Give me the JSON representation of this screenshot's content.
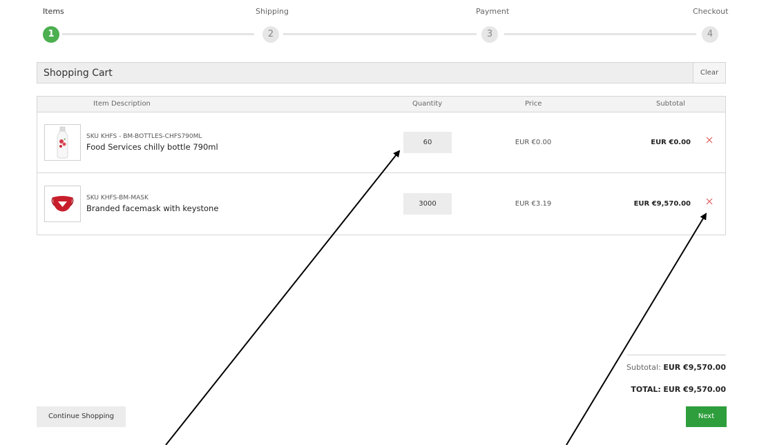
{
  "steps": [
    {
      "label": "Items",
      "number": "1"
    },
    {
      "label": "Shipping",
      "number": "2"
    },
    {
      "label": "Payment",
      "number": "3"
    },
    {
      "label": "Checkout",
      "number": "4"
    }
  ],
  "cart": {
    "title": "Shopping Cart",
    "clear_label": "Clear",
    "columns": {
      "description": "Item Description",
      "quantity": "Quantity",
      "price": "Price",
      "subtotal": "Subtotal"
    },
    "items": [
      {
        "sku": "SKU KHFS - BM-BOTTLES-CHFS790ML",
        "name": "Food Services chilly bottle 790ml",
        "quantity": "60",
        "price": "EUR €0.00",
        "subtotal": "EUR €0.00",
        "thumb_icon": "bottle-icon",
        "remove_icon": "close-icon"
      },
      {
        "sku": "SKU KHFS-BM-MASK",
        "name": "Branded facemask with keystone",
        "quantity": "3000",
        "price": "EUR €3.19",
        "subtotal": "EUR €9,570.00",
        "thumb_icon": "facemask-icon",
        "remove_icon": "close-icon"
      }
    ]
  },
  "summary": {
    "subtotal_label": "Subtotal:",
    "subtotal_value": "EUR €9,570.00",
    "total_label": "TOTAL:",
    "total_value": "EUR €9,570.00"
  },
  "buttons": {
    "continue": "Continue Shopping",
    "next": "Next"
  },
  "colors": {
    "active_step": "#4caf50",
    "next_button": "#2e9e3c",
    "remove": "#e05a5a"
  }
}
